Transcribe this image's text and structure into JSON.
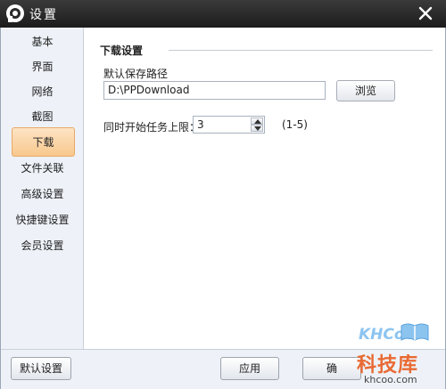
{
  "window": {
    "title": "设置"
  },
  "sidebar": {
    "items": [
      {
        "label": "基本"
      },
      {
        "label": "界面"
      },
      {
        "label": "网络"
      },
      {
        "label": "截图"
      },
      {
        "label": "下载"
      },
      {
        "label": "文件关联"
      },
      {
        "label": "高级设置"
      },
      {
        "label": "快捷键设置"
      },
      {
        "label": "会员设置"
      }
    ],
    "active_index": 4
  },
  "download": {
    "section_title": "下载设置",
    "path_label": "默认保存路径",
    "path_value": "D:\\PPDownload",
    "browse_label": "浏览",
    "limit_label": "同时开始任务上限：",
    "limit_value": "3",
    "limit_range": "(1-5)"
  },
  "footer": {
    "default_label": "默认设置",
    "apply_label": "应用",
    "ok_label": "确"
  },
  "watermark": {
    "brand": "KHCoo",
    "name_cn": "科技库",
    "url": "khcoo.com"
  },
  "colors": {
    "titlebar": "#2a2a2a",
    "sidebar_bg": "#eef2f8",
    "active_item": "#f8c88d",
    "watermark_orange": "#e96a33",
    "watermark_blue": "#8cc4f0"
  },
  "icons": {
    "app": "pptv-logo-icon",
    "close": "close-icon",
    "spin_up": "chevron-up-icon",
    "spin_down": "chevron-down-icon"
  }
}
